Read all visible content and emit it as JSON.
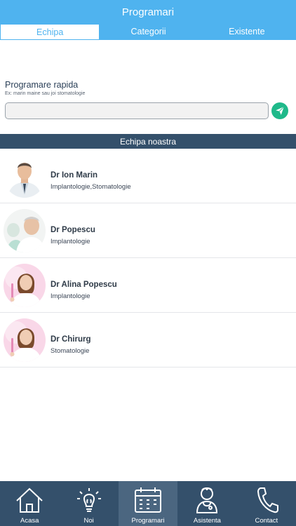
{
  "header": {
    "title": "Programari"
  },
  "tabs": [
    {
      "label": "Echipa",
      "active": true
    },
    {
      "label": "Categorii",
      "active": false
    },
    {
      "label": "Existente",
      "active": false
    }
  ],
  "quick_booking": {
    "label": "Programare rapida",
    "hint": "Ex: marin maine sau joi stomatologie",
    "value": "",
    "send_icon": "paper-plane-icon"
  },
  "team": {
    "title": "Echipa noastra",
    "doctors": [
      {
        "name": "Dr Ion Marin",
        "specialty": "Implantologie,Stomatologie"
      },
      {
        "name": "Dr Popescu",
        "specialty": "Implantologie"
      },
      {
        "name": "Dr Alina Popescu",
        "specialty": "Implantologie"
      },
      {
        "name": "Dr Chirurg",
        "specialty": "Stomatologie"
      }
    ]
  },
  "bottom_nav": [
    {
      "label": "Acasa",
      "icon": "home-icon",
      "active": false
    },
    {
      "label": "Noi",
      "icon": "lightbulb-icon",
      "active": false
    },
    {
      "label": "Programari",
      "icon": "calendar-icon",
      "active": true
    },
    {
      "label": "Asistenta",
      "icon": "nurse-icon",
      "active": false
    },
    {
      "label": "Contact",
      "icon": "phone-icon",
      "active": false
    }
  ],
  "colors": {
    "primary": "#4fb3ef",
    "dark": "#34506b",
    "accent_green": "#1fb98a"
  }
}
